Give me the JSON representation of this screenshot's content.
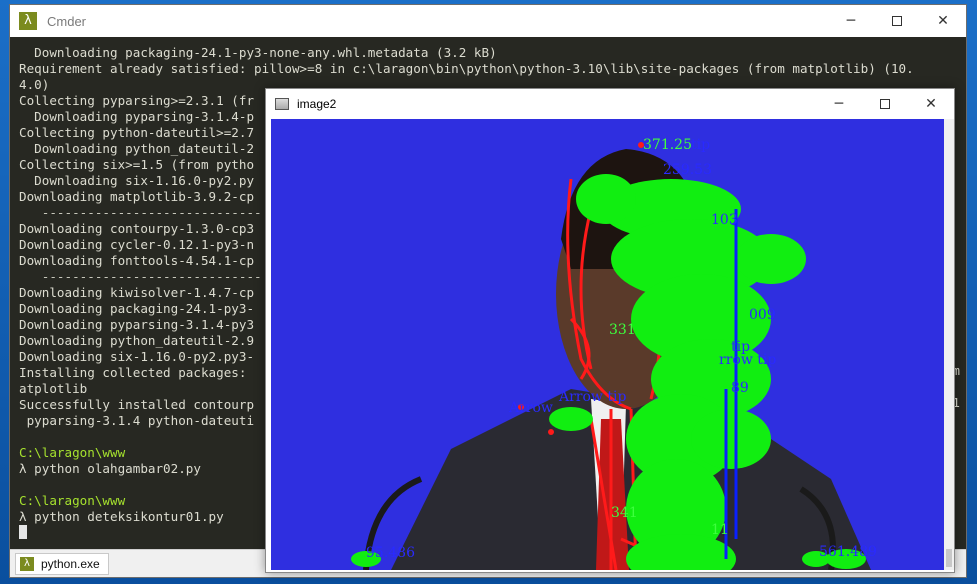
{
  "cmder": {
    "title": "Cmder",
    "tab_label": "python.exe",
    "lines": [
      {
        "text": "  Downloading packaging-24.1-py3-none-any.whl.metadata (3.2 kB)",
        "style": ""
      },
      {
        "text": "Requirement already satisfied: pillow>=8 in c:\\laragon\\bin\\python\\python-3.10\\lib\\site-packages (from matplotlib) (10.",
        "style": ""
      },
      {
        "text": "4.0)",
        "style": ""
      },
      {
        "text": "Collecting pyparsing>=2.3.1 (fr",
        "style": ""
      },
      {
        "text": "  Downloading pyparsing-3.1.4-p",
        "style": ""
      },
      {
        "text": "Collecting python-dateutil>=2.7",
        "style": ""
      },
      {
        "text": "  Downloading python_dateutil-2",
        "style": ""
      },
      {
        "text": "Collecting six>=1.5 (from pytho",
        "style": ""
      },
      {
        "text": "  Downloading six-1.16.0-py2.py",
        "style": ""
      },
      {
        "text": "Downloading matplotlib-3.9.2-cp",
        "style": ""
      },
      {
        "text": "   -----------------------------",
        "style": "dim"
      },
      {
        "text": "Downloading contourpy-1.3.0-cp3",
        "style": ""
      },
      {
        "text": "Downloading cycler-0.12.1-py3-n",
        "style": ""
      },
      {
        "text": "Downloading fonttools-4.54.1-cp",
        "style": ""
      },
      {
        "text": "   -----------------------------",
        "style": "dim"
      },
      {
        "text": "Downloading kiwisolver-1.4.7-cp",
        "style": ""
      },
      {
        "text": "Downloading packaging-24.1-py3-",
        "style": ""
      },
      {
        "text": "Downloading pyparsing-3.1.4-py3",
        "style": ""
      },
      {
        "text": "Downloading python_dateutil-2.9",
        "style": ""
      },
      {
        "text": "Downloading six-1.16.0-py2.py3-",
        "style": ""
      },
      {
        "text": "Installing collected packages: ",
        "style": ""
      },
      {
        "text": "atplotlib",
        "style": ""
      },
      {
        "text": "Successfully installed contourp",
        "style": ""
      },
      {
        "text": " pyparsing-3.1.4 python-dateuti",
        "style": ""
      },
      {
        "text": "",
        "style": ""
      },
      {
        "text": "C:\\laragon\\www",
        "style": "green"
      },
      {
        "text": "λ python olahgambar02.py",
        "style": ""
      },
      {
        "text": "",
        "style": ""
      },
      {
        "text": "C:\\laragon\\www",
        "style": "green"
      },
      {
        "text": "λ python deteksikontur01.py",
        "style": ""
      }
    ],
    "right_fragments": {
      "m": "m",
      "one": ".1"
    }
  },
  "image_window": {
    "title": "image2",
    "labels": [
      "371.25",
      "tip",
      "259.53",
      "103",
      "009",
      "tip",
      "rrow tip",
      "Arrow tip",
      "Arrow",
      "89",
      "331",
      "95.486",
      "561.489",
      "11",
      "341"
    ]
  }
}
